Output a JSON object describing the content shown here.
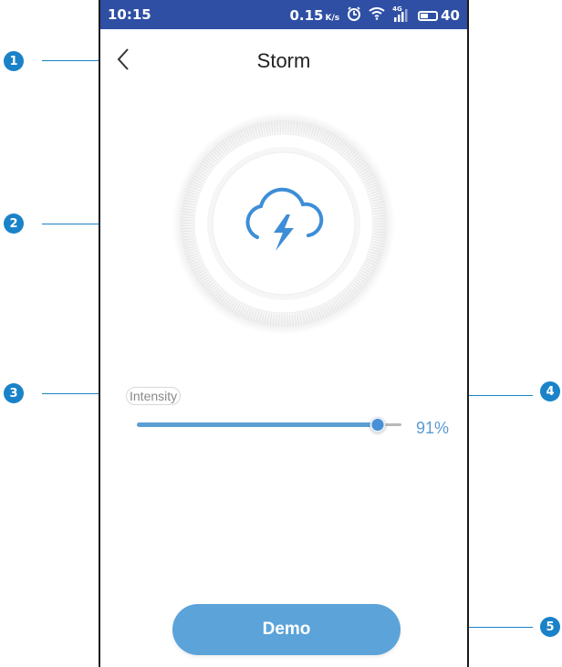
{
  "status_bar": {
    "time": "10:15",
    "speed": "0.15",
    "speed_unit": "K/s",
    "network": "4G",
    "battery": "40"
  },
  "header": {
    "title": "Storm"
  },
  "dial": {
    "icon": "storm-cloud-lightning-icon"
  },
  "intensity": {
    "label": "Intensity",
    "value_percent": 91,
    "value_text": "91%"
  },
  "demo_button": {
    "label": "Demo"
  },
  "callouts": [
    "1",
    "2",
    "3",
    "4",
    "5"
  ],
  "colors": {
    "status_bar": "#2f4fa5",
    "accent": "#5ba3d9",
    "callout": "#1a82c8"
  }
}
